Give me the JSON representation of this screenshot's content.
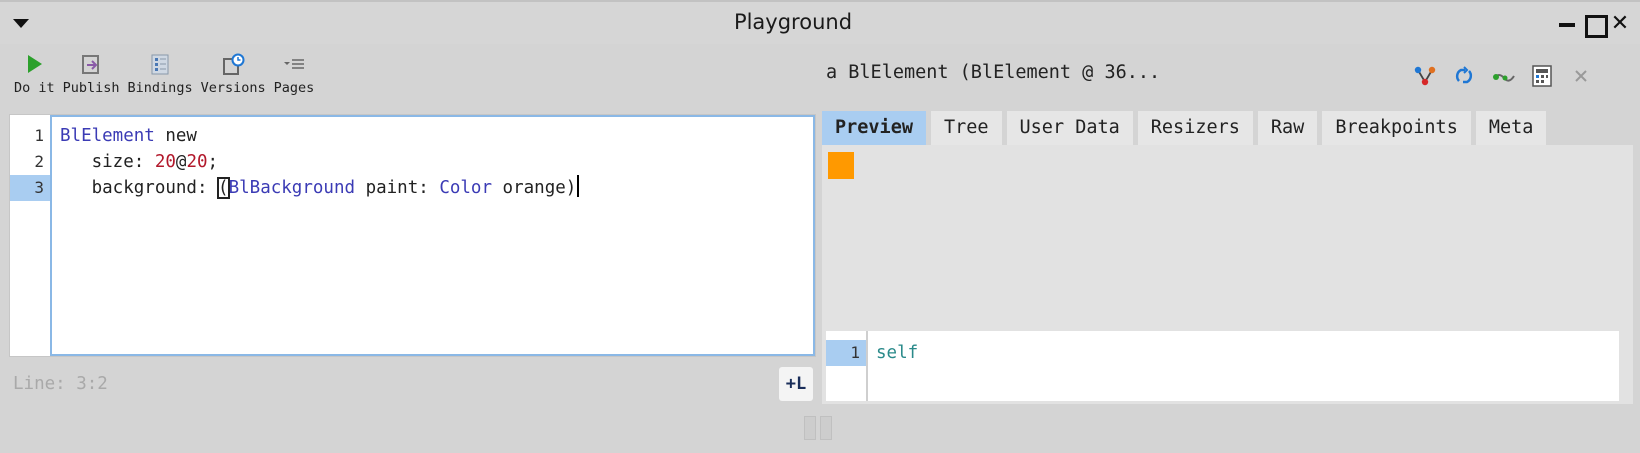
{
  "window": {
    "title": "Playground",
    "close_glyph": "✕"
  },
  "toolbar": [
    {
      "label": "Do it",
      "icon": "play-icon"
    },
    {
      "label": "Publish",
      "icon": "publish-icon"
    },
    {
      "label": "Bindings",
      "icon": "bindings-icon"
    },
    {
      "label": "Versions",
      "icon": "versions-icon"
    },
    {
      "label": "Pages",
      "icon": "pages-icon"
    }
  ],
  "editor": {
    "line_numbers": [
      "1",
      "2",
      "3"
    ],
    "current_line": 3,
    "lines": [
      [
        {
          "t": "BlElement",
          "c": "cls"
        },
        {
          "t": " new",
          "c": "sym"
        }
      ],
      [
        {
          "t": "   size: ",
          "c": "sym"
        },
        {
          "t": "20",
          "c": "num"
        },
        {
          "t": "@",
          "c": "sym"
        },
        {
          "t": "20",
          "c": "num"
        },
        {
          "t": ";",
          "c": "sym"
        }
      ],
      [
        {
          "t": "   background: ",
          "c": "sym"
        },
        {
          "t": "(",
          "c": "bracket"
        },
        {
          "t": "BlBackground",
          "c": "cls"
        },
        {
          "t": " paint: ",
          "c": "sym"
        },
        {
          "t": "Color",
          "c": "cls"
        },
        {
          "t": " orange)",
          "c": "sym"
        }
      ]
    ],
    "status": "Line: 3:2",
    "add_line_label": "+L"
  },
  "inspector": {
    "title": "a BlElement (BlElement @ 36...",
    "actions": [
      "graph-icon",
      "refresh-icon",
      "link-icon",
      "calculator-icon",
      "close-icon"
    ],
    "tabs": [
      "Preview",
      "Tree",
      "User Data",
      "Resizers",
      "Raw",
      "Breakpoints",
      "Meta"
    ],
    "active_tab": "Preview",
    "preview_color": "#ff9900",
    "eval": {
      "line_number": "1",
      "code": "self"
    }
  },
  "colors": {
    "accent_selection": "#a9cdf1",
    "play_green": "#2ca02c",
    "icon_blue": "#1f77d4"
  }
}
